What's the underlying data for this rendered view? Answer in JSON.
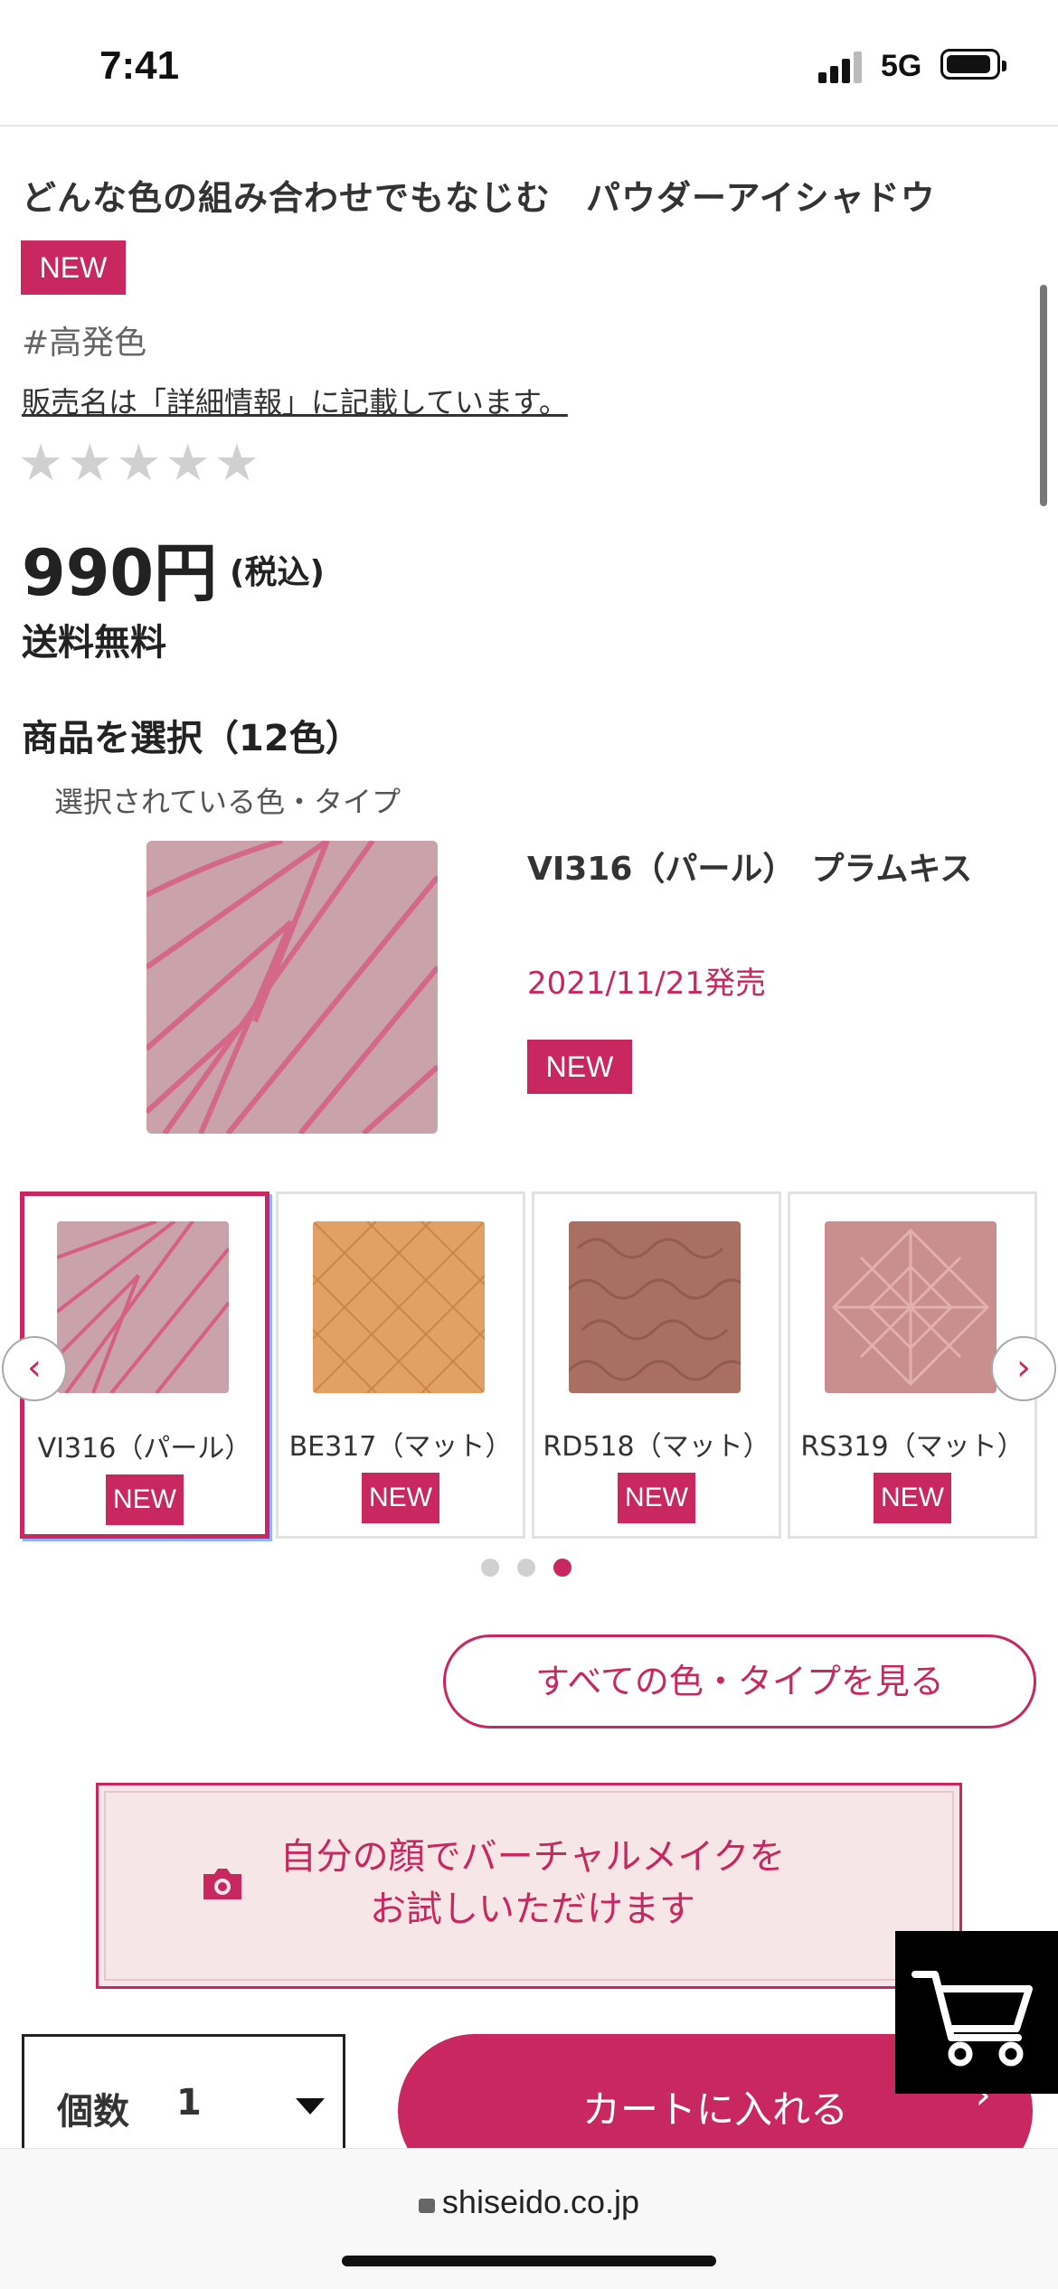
{
  "status": {
    "time": "7:41",
    "network": "5G"
  },
  "product": {
    "title": "どんな色の組み合わせでもなじむ　パウダーアイシャドウ",
    "badge": "NEW",
    "hashtag": "#高発色",
    "seller_note": "販売名は「詳細情報」に記載しています。",
    "rating": {
      "stars": "★★★★★",
      "value": 0,
      "max": 5
    },
    "price": "990円",
    "tax_note": "(税込)",
    "shipping": "送料無料"
  },
  "selection": {
    "title": "商品を選択（12色）",
    "selected_label": "選択されている色・タイプ",
    "selected": {
      "name": "VI316（パール）　プラムキス",
      "release": "2021/11/21発売",
      "badge": "NEW"
    },
    "options": [
      {
        "name": "VI316（パール）",
        "badge": "NEW",
        "active": true,
        "swatch": "pink-stripe"
      },
      {
        "name": "BE317（マット）",
        "badge": "NEW",
        "active": false,
        "swatch": "beige-quilt"
      },
      {
        "name": "RD518（マット）",
        "badge": "NEW",
        "active": false,
        "swatch": "brown-script"
      },
      {
        "name": "RS319（マット）",
        "badge": "NEW",
        "active": false,
        "swatch": "rose-facet"
      }
    ],
    "pager": {
      "pages": 3,
      "current": 3
    },
    "all_colors_label": "すべての色・タイプを見る"
  },
  "virtual_makeup": {
    "line1": "自分の顔でバーチャルメイクを",
    "line2": "お試しいただけます"
  },
  "purchase": {
    "qty_label": "個数",
    "qty_value": "1",
    "add_to_cart": "カートに入れる"
  },
  "browser": {
    "domain": "shiseido.co.jp"
  },
  "colors": {
    "accent": "#c8275f",
    "vm_bg": "#f7e6e8"
  }
}
